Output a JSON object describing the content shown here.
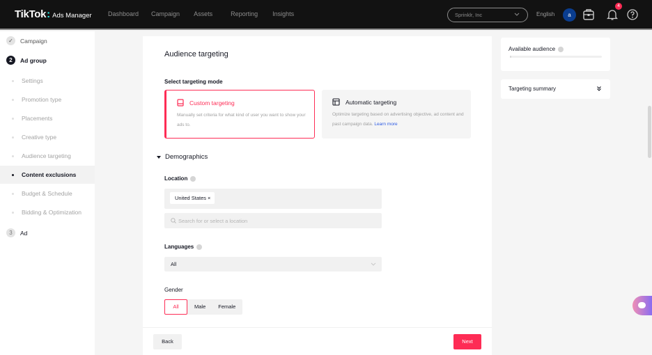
{
  "topbar": {
    "logo_brand": "TikTok",
    "logo_product": "Ads Manager",
    "nav": [
      "Dashboard",
      "Campaign",
      "Assets",
      "Reporting",
      "Insights"
    ],
    "account": "Sprinklr, Inc",
    "language": "English",
    "avatar_initial": "a",
    "notification_count": "4",
    "icons": [
      "briefcase-icon",
      "bell-icon",
      "help-icon"
    ]
  },
  "sidebar": {
    "steps": [
      {
        "number": "✓",
        "label": "Campaign",
        "state": "done"
      },
      {
        "number": "2",
        "label": "Ad group",
        "state": "active"
      },
      {
        "number": "3",
        "label": "Ad",
        "state": "todo"
      }
    ],
    "substeps": [
      {
        "label": "Settings",
        "current": false
      },
      {
        "label": "Promotion type",
        "current": false
      },
      {
        "label": "Placements",
        "current": false
      },
      {
        "label": "Creative type",
        "current": false
      },
      {
        "label": "Audience targeting",
        "current": false
      },
      {
        "label": "Content exclusions",
        "current": true
      },
      {
        "label": "Budget & Schedule",
        "current": false
      },
      {
        "label": "Bidding & Optimization",
        "current": false
      }
    ]
  },
  "main": {
    "title": "Audience targeting",
    "mode_label": "Select targeting mode",
    "modes": {
      "custom": {
        "title": "Custom targeting",
        "description": "Manually set criteria for what kind of user you want to show your ads to.",
        "selected": true
      },
      "automatic": {
        "title": "Automatic targeting",
        "description": "Optimize targeting based on advertising objective, ad content and past campaign data.",
        "link": "Learn more",
        "selected": false
      }
    },
    "demographics_label": "Demographics",
    "location": {
      "label": "Location",
      "tags": [
        "United States"
      ],
      "tag_remove": "×",
      "search_placeholder": "Search for or select a location"
    },
    "languages": {
      "label": "Languages",
      "value": "All"
    },
    "gender": {
      "label": "Gender",
      "options": [
        "All",
        "Male",
        "Female"
      ],
      "selected": "All"
    },
    "back_label": "Back",
    "next_label": "Next"
  },
  "right": {
    "available_audience_label": "Available audience",
    "targeting_summary_label": "Targeting summary"
  },
  "colors": {
    "accent": "#fe2c55",
    "link": "#2d5be3",
    "topbar": "#121212"
  }
}
